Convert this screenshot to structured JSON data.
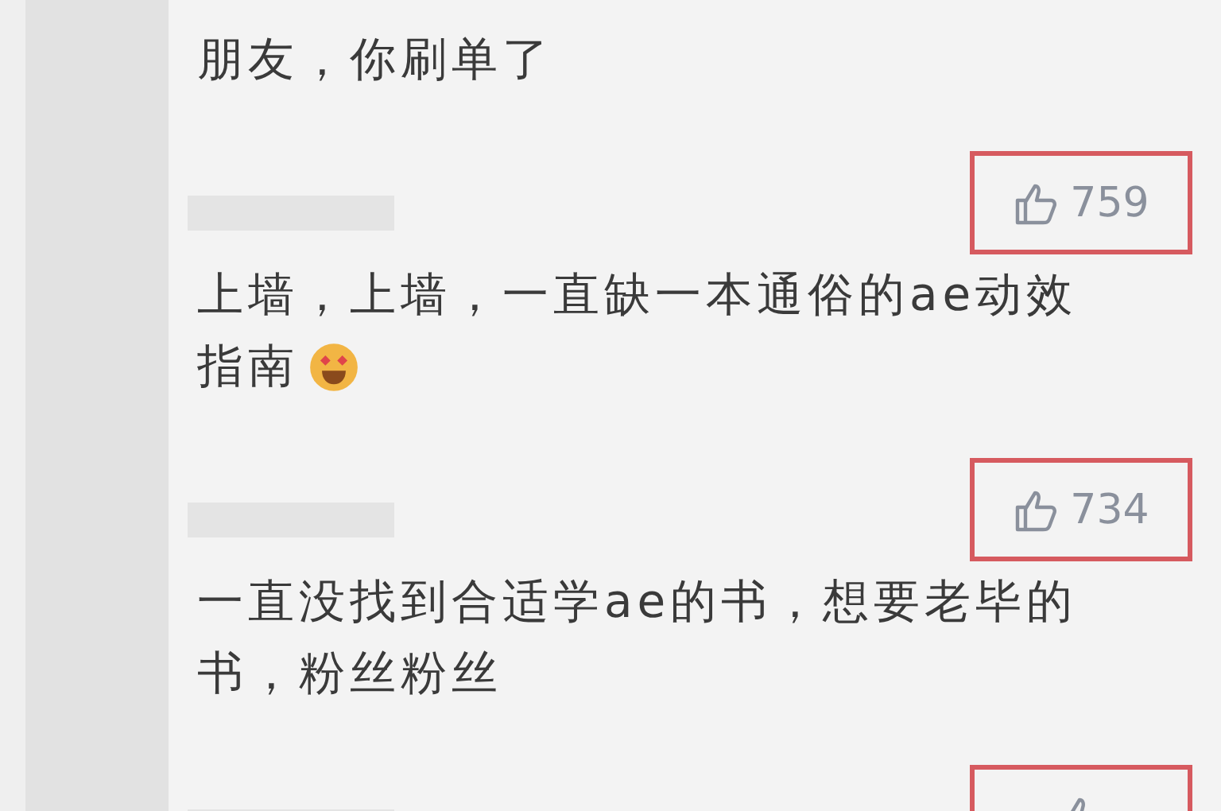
{
  "comments": [
    {
      "lines": [
        "朋友，你刷单了"
      ]
    },
    {
      "likes": "759",
      "highlighted": true,
      "lines": [
        "上墙，上墙，一直缺一本通俗的ae动效",
        "指南"
      ],
      "emoji": true
    },
    {
      "likes": "734",
      "highlighted": true,
      "lines": [
        "一直没找到合适学ae的书，想要老毕的",
        "书，粉丝粉丝"
      ]
    },
    {
      "highlighted": true
    }
  ]
}
